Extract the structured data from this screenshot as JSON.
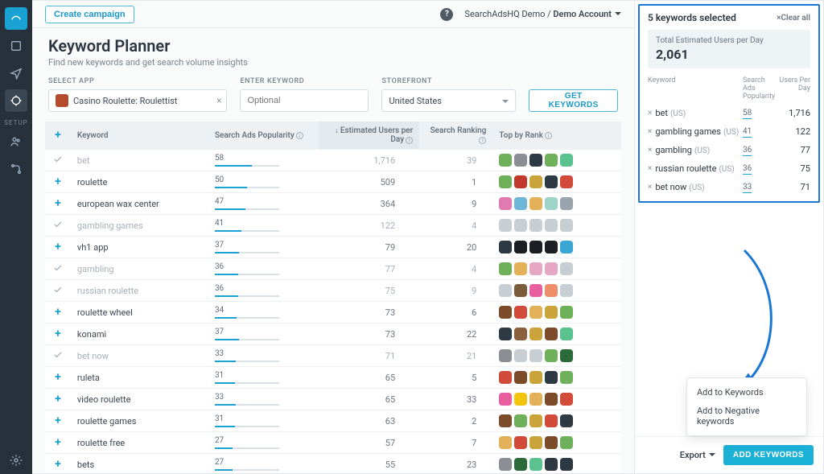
{
  "topbar": {
    "create": "Create campaign",
    "account_prefix": "SearchAdsHQ Demo / ",
    "account_name": "Demo Account"
  },
  "header": {
    "title": "Keyword Planner",
    "subtitle": "Find new keywords and get search volume insights"
  },
  "filters": {
    "app_label": "SELECT APP",
    "app_value": "Casino Roulette: Roulettist",
    "kw_label": "ENTER KEYWORD",
    "kw_placeholder": "Optional",
    "store_label": "STOREFRONT",
    "store_value": "United States",
    "get_btn": "GET KEYWORDS"
  },
  "columns": {
    "keyword": "Keyword",
    "popularity": "Search Ads Popularity",
    "users": "Estimated Users per Day",
    "rank": "Search Ranking",
    "top": "Top by Rank"
  },
  "rows": [
    {
      "sel": true,
      "kw": "bet",
      "pop": 58,
      "users": "1,716",
      "rank": 39,
      "colors": [
        "#6fb05a",
        "#8b8f93",
        "#2d3a44",
        "#6fb05a",
        "#59c28e"
      ]
    },
    {
      "sel": false,
      "kw": "roulette",
      "pop": 50,
      "users": "509",
      "rank": 1,
      "colors": [
        "#6fb05a",
        "#c0392b",
        "#caa33b",
        "#2d3a44",
        "#d24a3a"
      ]
    },
    {
      "sel": false,
      "kw": "european wax center",
      "pop": 47,
      "users": "364",
      "rank": 9,
      "colors": [
        "#e07ab0",
        "#6fb7d6",
        "#e3b15a",
        "#9dd4c7",
        "#9aa4ae"
      ]
    },
    {
      "sel": true,
      "kw": "gambling games",
      "pop": 41,
      "users": "122",
      "rank": 4,
      "colors": [
        "#c7cfd5",
        "#c7cfd5",
        "#c7cfd5",
        "#c7cfd5",
        "#c7cfd5"
      ]
    },
    {
      "sel": false,
      "kw": "vh1 app",
      "pop": 37,
      "users": "79",
      "rank": 20,
      "colors": [
        "#2d3a44",
        "#1b1f23",
        "#1b1f23",
        "#1b1f23",
        "#3aa6d4"
      ]
    },
    {
      "sel": true,
      "kw": "gambling",
      "pop": 36,
      "users": "77",
      "rank": 4,
      "colors": [
        "#6fb05a",
        "#e3b15a",
        "#e6a7c4",
        "#e6a7c4",
        "#c7cfd5"
      ]
    },
    {
      "sel": true,
      "kw": "russian roulette",
      "pop": 36,
      "users": "75",
      "rank": 9,
      "colors": [
        "#c7cfd5",
        "#7a5c3a",
        "#e85fa0",
        "#ef8f6a",
        "#c7cfd5"
      ]
    },
    {
      "sel": false,
      "kw": "roulette wheel",
      "pop": 34,
      "users": "73",
      "rank": 6,
      "colors": [
        "#7b4b2a",
        "#d24a3a",
        "#e3b15a",
        "#caa33b",
        "#6fb05a"
      ]
    },
    {
      "sel": false,
      "kw": "konami",
      "pop": 37,
      "users": "73",
      "rank": 22,
      "colors": [
        "#2d3a44",
        "#8b5e3c",
        "#caa33b",
        "#7b4b2a",
        "#59c28e"
      ]
    },
    {
      "sel": true,
      "kw": "bet now",
      "pop": 33,
      "users": "71",
      "rank": 21,
      "colors": [
        "#8b8f93",
        "#c7cfd5",
        "#c7cfd5",
        "#6fb05a",
        "#2d6a3a"
      ]
    },
    {
      "sel": false,
      "kw": "ruleta",
      "pop": 31,
      "users": "65",
      "rank": 5,
      "colors": [
        "#d24a3a",
        "#7b4b2a",
        "#caa33b",
        "#2d3a44",
        "#6fb05a"
      ]
    },
    {
      "sel": false,
      "kw": "video roulette",
      "pop": 33,
      "users": "65",
      "rank": 33,
      "colors": [
        "#e85fa0",
        "#f1c40f",
        "#e3b15a",
        "#7b4b2a",
        "#d24a3a"
      ]
    },
    {
      "sel": false,
      "kw": "roulette games",
      "pop": 31,
      "users": "63",
      "rank": 2,
      "colors": [
        "#7b4b2a",
        "#6fb05a",
        "#caa33b",
        "#d24a3a",
        "#2d3a44"
      ]
    },
    {
      "sel": false,
      "kw": "roulette free",
      "pop": 27,
      "users": "57",
      "rank": 7,
      "colors": [
        "#e3b15a",
        "#d24a3a",
        "#caa33b",
        "#7b4b2a",
        "#6fb05a"
      ]
    },
    {
      "sel": false,
      "kw": "bets",
      "pop": 27,
      "users": "55",
      "rank": 23,
      "colors": [
        "#8b8f93",
        "#2d6a3a",
        "#59c28e",
        "#2d3a44",
        "#2d3a44"
      ]
    }
  ],
  "side": {
    "title": "5 keywords selected",
    "clear": "×Clear all",
    "total_label": "Total Estimated Users per Day",
    "total_value": "2,061",
    "hdr_kw": "Keyword",
    "hdr_pop": "Search Ads Popularity",
    "hdr_users": "Users Per Day",
    "items": [
      {
        "kw": "bet",
        "cc": "(US)",
        "pop": 58,
        "users": "1,716"
      },
      {
        "kw": "gambling games",
        "cc": "(US)",
        "pop": 41,
        "users": "122"
      },
      {
        "kw": "gambling",
        "cc": "(US)",
        "pop": 36,
        "users": "77"
      },
      {
        "kw": "russian roulette",
        "cc": "(US)",
        "pop": 36,
        "users": "75"
      },
      {
        "kw": "bet now",
        "cc": "(US)",
        "pop": 33,
        "users": "71"
      }
    ],
    "popover": {
      "opt1": "Add to Keywords",
      "opt2": "Add to Negative keywords"
    },
    "export": "Export",
    "add": "ADD KEYWORDS"
  }
}
